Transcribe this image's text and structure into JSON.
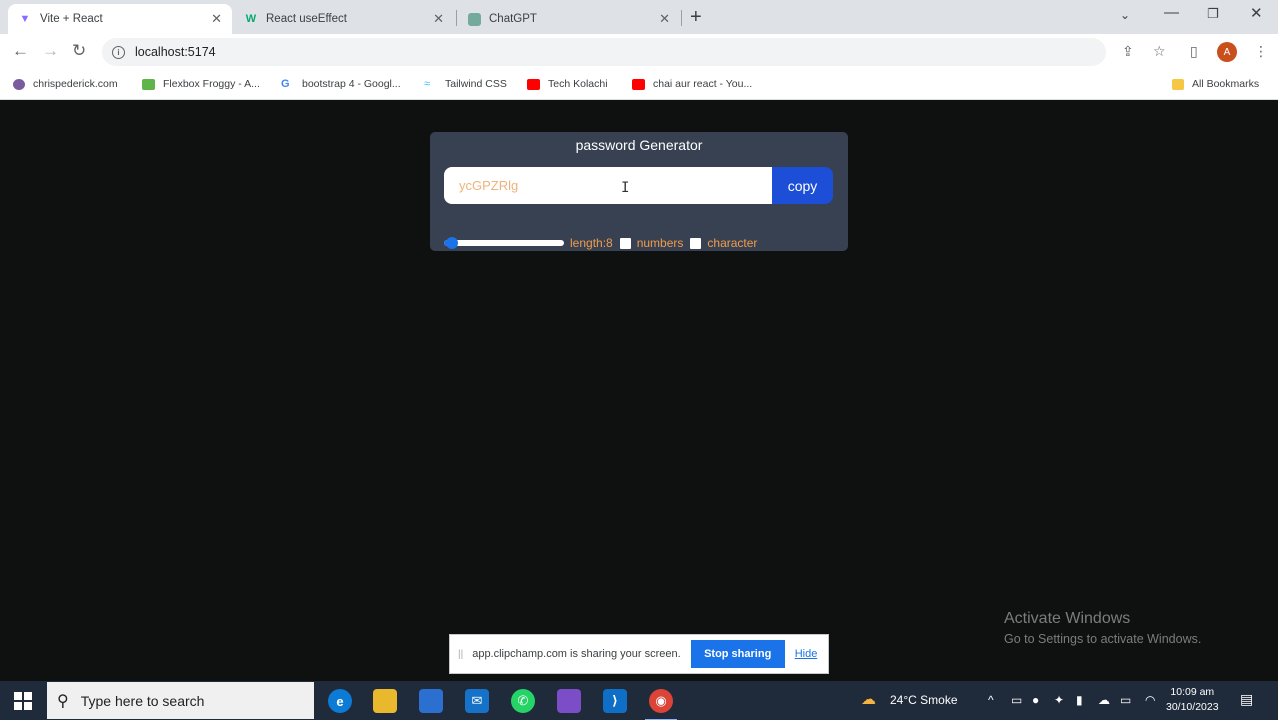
{
  "browser": {
    "tabs": [
      {
        "title": "Vite + React",
        "favicon": "vite-icon",
        "active": true
      },
      {
        "title": "React useEffect",
        "favicon": "w3schools-icon",
        "active": false
      },
      {
        "title": "ChatGPT",
        "favicon": "chatgpt-icon",
        "active": false
      }
    ],
    "url": "localhost:5174",
    "profile_initial": "A",
    "bookmarks": [
      {
        "label": "chrispederick.com",
        "icon": "globe-icon"
      },
      {
        "label": "Flexbox Froggy - A...",
        "icon": "frog-icon"
      },
      {
        "label": "bootstrap 4 - Googl...",
        "icon": "google-icon"
      },
      {
        "label": "Tailwind CSS",
        "icon": "tailwind-icon"
      },
      {
        "label": "Tech Kolachi",
        "icon": "youtube-icon"
      },
      {
        "label": "chai aur react - You...",
        "icon": "youtube-icon"
      }
    ],
    "all_bookmarks_label": "All Bookmarks"
  },
  "app": {
    "title": "password Generator",
    "password": "ycGPZRlg",
    "copy_label": "copy",
    "length_label": "length:8",
    "length_value": 8,
    "length_min": 6,
    "length_max": 100,
    "numbers_label": "numbers",
    "numbers_checked": false,
    "character_label": "character",
    "character_checked": false
  },
  "watermark": {
    "line1": "Activate Windows",
    "line2": "Go to Settings to activate Windows."
  },
  "share": {
    "message": "app.clipchamp.com is sharing your screen.",
    "stop_label": "Stop sharing",
    "hide_label": "Hide"
  },
  "taskbar": {
    "search_placeholder": "Type here to search",
    "weather": "24°C  Smoke",
    "time": "10:09 am",
    "date": "30/10/2023"
  },
  "colors": {
    "page_bg": "#0f1110",
    "card_bg": "#374151",
    "copy_button": "#1d4ed8",
    "accent_text": "#f29b4b"
  }
}
